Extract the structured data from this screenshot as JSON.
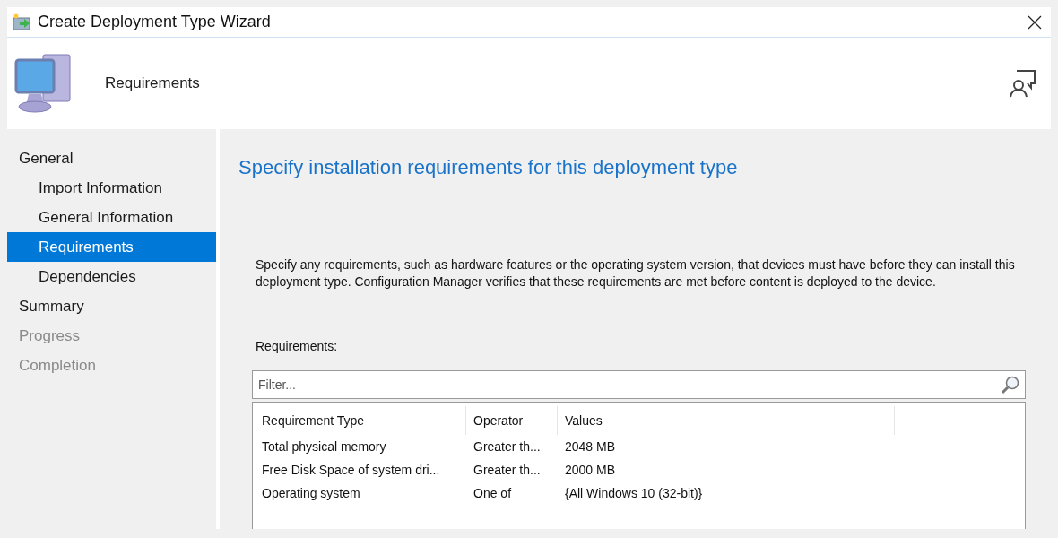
{
  "window": {
    "title": "Create Deployment Type Wizard"
  },
  "header": {
    "title": "Requirements"
  },
  "sidebar": {
    "items": [
      {
        "label": "General",
        "selected": false,
        "disabled": false,
        "children": [
          {
            "label": "Import Information",
            "selected": false,
            "disabled": false
          },
          {
            "label": "General Information",
            "selected": false,
            "disabled": false
          },
          {
            "label": "Requirements",
            "selected": true,
            "disabled": false
          },
          {
            "label": "Dependencies",
            "selected": false,
            "disabled": false
          }
        ]
      },
      {
        "label": "Summary",
        "selected": false,
        "disabled": false
      },
      {
        "label": "Progress",
        "selected": false,
        "disabled": true
      },
      {
        "label": "Completion",
        "selected": false,
        "disabled": true
      }
    ]
  },
  "content": {
    "heading": "Specify installation requirements for this deployment type",
    "description": "Specify any requirements, such as hardware features or the operating system version, that devices must have before they can install this deployment type. Configuration Manager verifies that these requirements are met before content is deployed to the device.",
    "list_label": "Requirements:",
    "filter": {
      "placeholder": "Filter..."
    },
    "table": {
      "columns": [
        "Requirement Type",
        "Operator",
        "Values"
      ],
      "rows": [
        [
          "Total physical memory",
          "Greater th...",
          "2048 MB"
        ],
        [
          "Free Disk Space of system dri...",
          "Greater th...",
          "2000 MB"
        ],
        [
          "Operating system",
          "One of",
          "{All Windows 10 (32-bit)}"
        ]
      ]
    }
  }
}
